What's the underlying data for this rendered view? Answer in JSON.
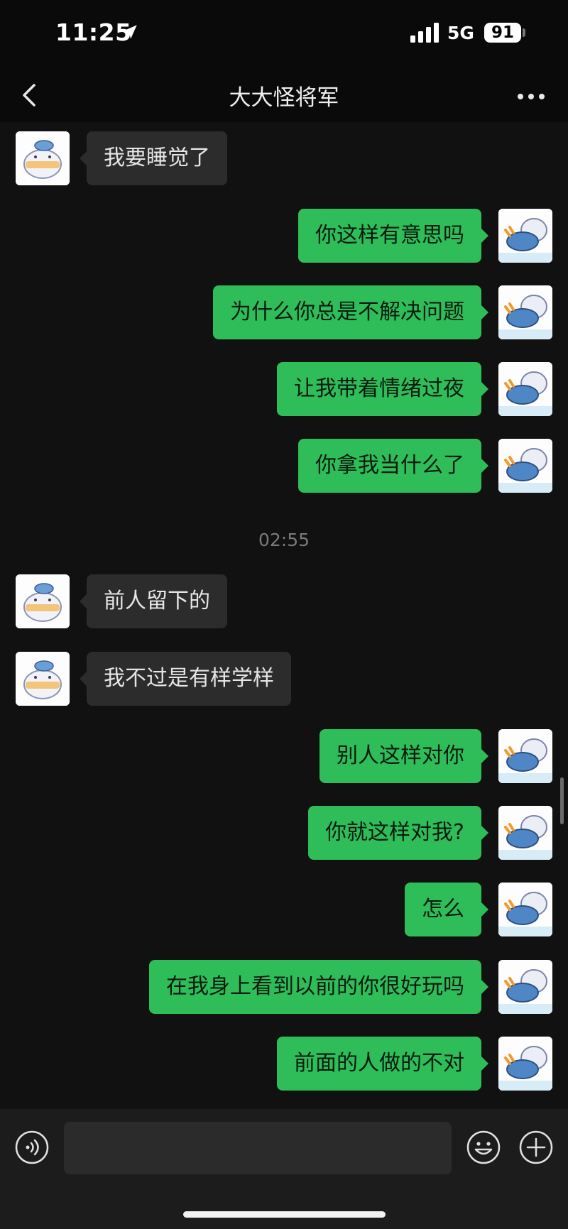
{
  "status_bar": {
    "time": "11:25",
    "network": "5G",
    "battery": "91"
  },
  "header": {
    "title": "大大怪将军"
  },
  "messages": [
    {
      "side": "left",
      "text": "我要睡觉了"
    },
    {
      "side": "right",
      "text": "你这样有意思吗"
    },
    {
      "side": "right",
      "text": "为什么你总是不解决问题"
    },
    {
      "side": "right",
      "text": "让我带着情绪过夜"
    },
    {
      "side": "right",
      "text": "你拿我当什么了"
    },
    {
      "side": "left",
      "text": "前人留下的"
    },
    {
      "side": "left",
      "text": "我不过是有样学样"
    },
    {
      "side": "right",
      "text": "别人这样对你"
    },
    {
      "side": "right",
      "text": "你就这样对我?"
    },
    {
      "side": "right",
      "text": "怎么"
    },
    {
      "side": "right",
      "text": "在我身上看到以前的你很好玩吗"
    },
    {
      "side": "right",
      "text": "前面的人做的不对"
    }
  ],
  "timestamp": "02:55",
  "icons": {
    "back": "chevron-left-icon",
    "more": "more-dots-icon",
    "voice": "voice-icon",
    "emoji": "emoji-icon",
    "plus": "plus-icon",
    "location": "location-arrow-icon"
  },
  "colors": {
    "sent_bubble": "#2ebd59",
    "received_bubble": "#2c2c2c",
    "background": "#111111"
  },
  "input": {
    "value": "",
    "placeholder": ""
  }
}
